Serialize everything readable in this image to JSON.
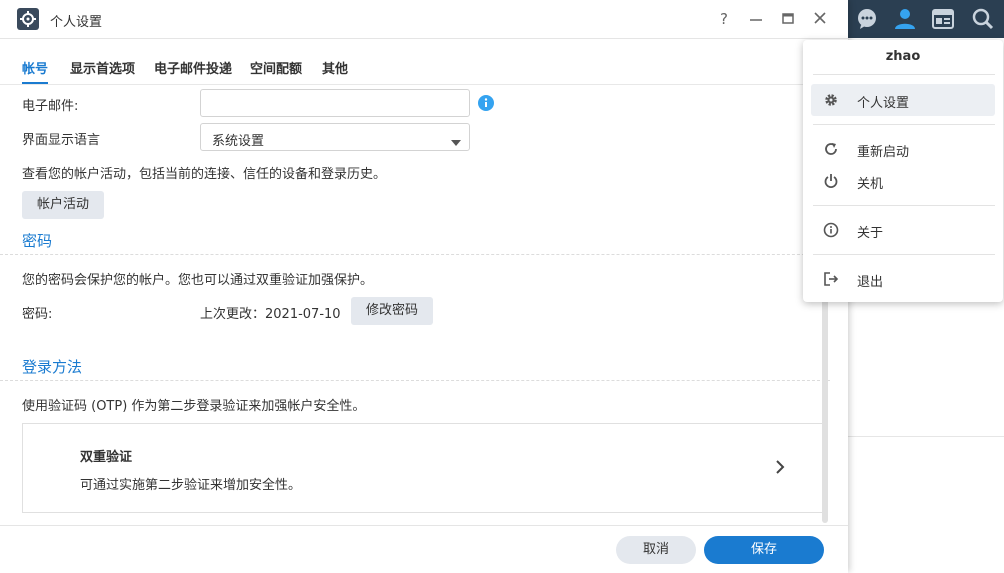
{
  "window": {
    "title": "个人设置"
  },
  "tabs": [
    {
      "label": "帐号",
      "active": true
    },
    {
      "label": "显示首选项"
    },
    {
      "label": "电子邮件投递"
    },
    {
      "label": "空间配额"
    },
    {
      "label": "其他"
    }
  ],
  "account": {
    "email_label": "电子邮件:",
    "email_value": "",
    "language_label": "界面显示语言",
    "language_value": "系统设置",
    "activity_text": "查看您的帐户活动，包括当前的连接、信任的设备和登录历史。",
    "activity_button": "帐户活动"
  },
  "password": {
    "section_title": "密码",
    "description": "您的密码会保护您的帐户。您也可以通过双重验证加强保护。",
    "label": "密码:",
    "last_changed": "上次更改：2021-07-10",
    "change_button": "修改密码"
  },
  "login": {
    "section_title": "登录方法",
    "description": "使用验证码 (OTP) 作为第二步登录验证来加强帐户安全性。",
    "card_title": "双重验证",
    "card_desc": "可通过实施第二步验证来增加安全性。"
  },
  "footer": {
    "cancel": "取消",
    "save": "保存"
  },
  "user_menu": {
    "username": "zhao",
    "items": [
      {
        "label": "个人设置",
        "icon": "gear-icon"
      },
      {
        "label": "重新启动",
        "icon": "restart-icon"
      },
      {
        "label": "关机",
        "icon": "power-icon"
      },
      {
        "label": "关于",
        "icon": "info-icon"
      },
      {
        "label": "退出",
        "icon": "logout-icon"
      }
    ]
  },
  "colors": {
    "accent": "#1a7bd0",
    "taskbar": "#2b3f52"
  }
}
